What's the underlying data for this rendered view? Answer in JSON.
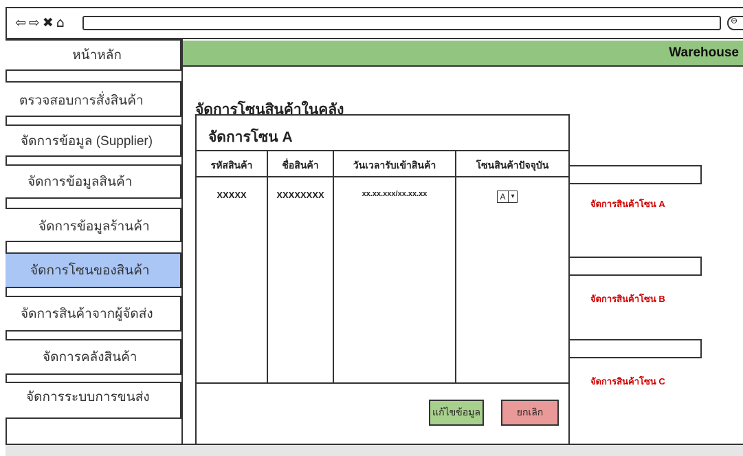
{
  "browser": {
    "nav_icons": [
      "back-icon",
      "forward-icon",
      "close-icon",
      "home-icon"
    ]
  },
  "header": {
    "brand": "Warehouse",
    "color": "#92c57f"
  },
  "sidebar": {
    "items": [
      {
        "label": "หน้าหลัก",
        "active": false
      },
      {
        "label": "ตรวจสอบการสั่งสินค้า",
        "active": false
      },
      {
        "label": "จัดการข้อมูล (Supplier)",
        "active": false
      },
      {
        "label": "จัดการข้อมูลสินค้า",
        "active": false
      },
      {
        "label": "จัดการข้อมูลร้านค้า",
        "active": false
      },
      {
        "label": "จัดการโซนของสินค้า",
        "active": true
      },
      {
        "label": "จัดการสินค้าจากผู้จัดส่ง",
        "active": false
      },
      {
        "label": "จัดการคลังสินค้า",
        "active": false
      },
      {
        "label": "จัดการระบบการขนส่ง",
        "active": false
      }
    ],
    "active_color": "#a9c6f5"
  },
  "main": {
    "page_title": "จัดการโซนสินค้าในคลัง",
    "panel": {
      "title": "จัดการโซน A",
      "columns": [
        "รหัสสินค้า",
        "ชื่อสินค้า",
        "วันเวลารับเข้าสินค้า",
        "โซนสินค้าปัจจุบัน"
      ],
      "rows": [
        {
          "code": "XXXXX",
          "name": "XXXXXXXX",
          "received": "xx.xx.xxx/xx.xx.xx",
          "zone": "A"
        }
      ],
      "save_label": "แก้ไขข้อมูล",
      "cancel_label": "ยกเลิก",
      "save_color": "#a8d08d",
      "cancel_color": "#ea9999"
    },
    "zones": [
      {
        "label": "จัดการสินค้าโซน A"
      },
      {
        "label": "จัดการสินค้าโซน B"
      },
      {
        "label": "จัดการสินค้าโซน C"
      }
    ],
    "zone_link_color": "#d10000"
  }
}
